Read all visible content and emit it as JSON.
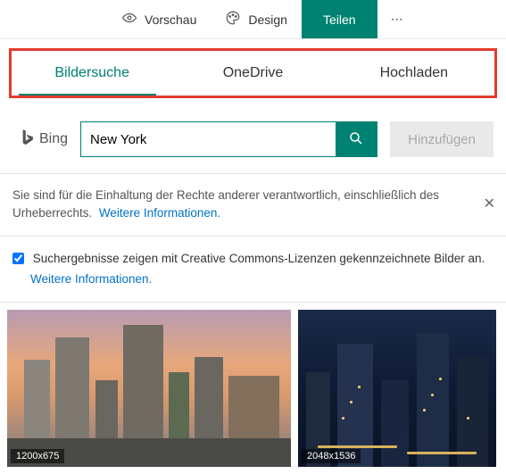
{
  "topbar": {
    "preview_label": "Vorschau",
    "design_label": "Design",
    "share_label": "Teilen"
  },
  "tabs": {
    "image_search": "Bildersuche",
    "onedrive": "OneDrive",
    "upload": "Hochladen"
  },
  "brand": {
    "name": "Bing"
  },
  "search": {
    "value": "New York"
  },
  "add_button": "Hinzufügen",
  "notice": {
    "text": "Sie sind für die Einhaltung der Rechte anderer verantwortlich, einschließlich des Urheberrechts.",
    "link": "Weitere Informationen."
  },
  "cc": {
    "checked": true,
    "label": "Suchergebnisse zeigen mit Creative Commons-Lizenzen gekennzeichnete Bilder an.",
    "link": "Weitere Informationen."
  },
  "results": [
    {
      "dimensions": "1200x675"
    },
    {
      "dimensions": "2048x1536"
    }
  ]
}
